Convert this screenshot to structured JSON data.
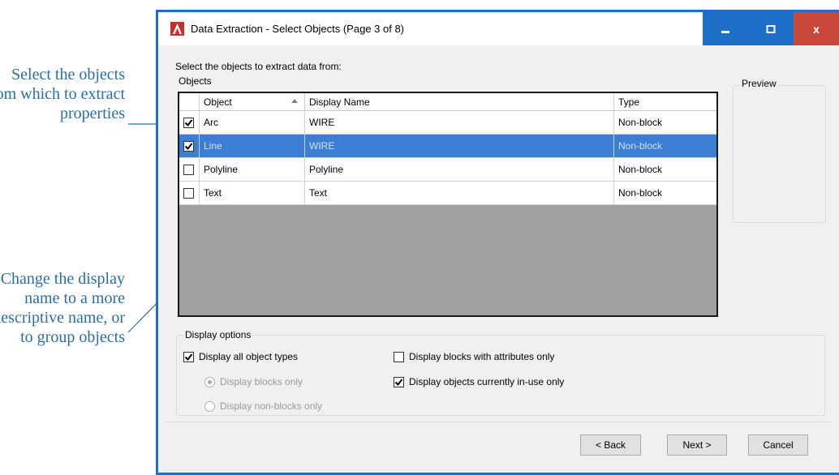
{
  "annotations": {
    "callout_1": "Select the objects from which to extract properties",
    "callout_2": "Change the display name to a more descriptive name, or to group objects"
  },
  "window": {
    "title": "Data Extraction - Select Objects (Page 3 of 8)",
    "minimize_glyph": "–",
    "maximize_glyph": "□",
    "close_glyph": "x"
  },
  "main": {
    "instruction": "Select the objects to extract data from:",
    "objects_label": "Objects",
    "preview_label": "Preview",
    "columns": {
      "object": "Object",
      "display_name": "Display Name",
      "type": "Type"
    },
    "rows": [
      {
        "checked": true,
        "object": "Arc",
        "display_name": "WIRE",
        "type": "Non-block",
        "selected": false
      },
      {
        "checked": true,
        "object": "Line",
        "display_name": "WIRE",
        "type": "Non-block",
        "selected": true
      },
      {
        "checked": false,
        "object": "Polyline",
        "display_name": "Polyline",
        "type": "Non-block",
        "selected": false
      },
      {
        "checked": false,
        "object": "Text",
        "display_name": "Text",
        "type": "Non-block",
        "selected": false
      }
    ]
  },
  "display_options": {
    "label": "Display options",
    "all_types": {
      "label": "Display all object types",
      "checked": true
    },
    "blocks_only": {
      "label": "Display blocks only",
      "selected": true,
      "enabled": false
    },
    "non_blocks_only": {
      "label": "Display non-blocks only",
      "selected": false,
      "enabled": false
    },
    "blocks_with_attrs": {
      "label": "Display blocks with attributes only",
      "checked": false
    },
    "in_use_only": {
      "label": "Display objects currently in-use only",
      "checked": true
    }
  },
  "footer": {
    "back": "< Back",
    "next": "Next >",
    "cancel": "Cancel"
  },
  "colors": {
    "accent": "#1d6fc8",
    "selection": "#3c7ed4",
    "close": "#c9483c",
    "callout": "#2a6ea6"
  }
}
